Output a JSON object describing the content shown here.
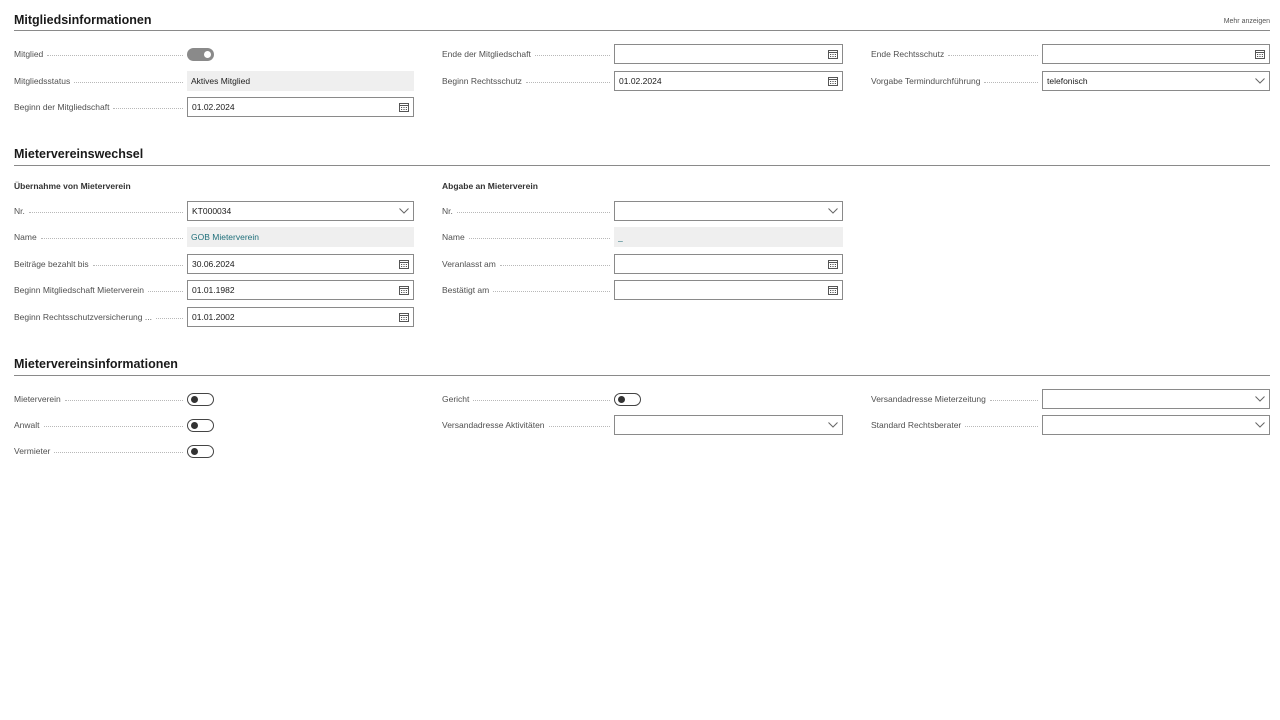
{
  "header": {
    "more_link": "Mehr anzeigen"
  },
  "sections": {
    "mitglied": "Mitgliedsinformationen",
    "wechsel": "Mietervereinswechsel",
    "info": "Mietervereinsinformationen"
  },
  "mitglied": {
    "mitglied_label": "Mitglied",
    "mitglied_toggle": "on",
    "status_label": "Mitgliedsstatus",
    "status_value": "Aktives Mitglied",
    "beginn_label": "Beginn der Mitgliedschaft",
    "beginn_value": "01.02.2024",
    "ende_label": "Ende der Mitgliedschaft",
    "ende_value": "",
    "beginn_rs_label": "Beginn Rechtsschutz",
    "beginn_rs_value": "01.02.2024",
    "ende_rs_label": "Ende Rechtsschutz",
    "ende_rs_value": "",
    "vorgabe_label": "Vorgabe Termindurchführung",
    "vorgabe_value": "telefonisch"
  },
  "wechsel": {
    "uebernahme_title": "Übernahme von Mieterverein",
    "abgabe_title": "Abgabe an Mieterverein",
    "nr_label": "Nr.",
    "nr_value": "KT000034",
    "name_label": "Name",
    "name_value": "GOB Mieterverein",
    "beitraege_label": "Beiträge bezahlt bis",
    "beitraege_value": "30.06.2024",
    "beginn_mv_label": "Beginn Mitgliedschaft Mieterverein",
    "beginn_mv_value": "01.01.1982",
    "beginn_rsv_label": "Beginn Rechtsschutzversicherung ...",
    "beginn_rsv_value": "01.01.2002",
    "abgabe_nr_label": "Nr.",
    "abgabe_nr_value": "",
    "abgabe_name_label": "Name",
    "abgabe_name_value": "_",
    "veranlasst_label": "Veranlasst am",
    "veranlasst_value": "",
    "bestaetigt_label": "Bestätigt am",
    "bestaetigt_value": ""
  },
  "info": {
    "mieterverein_label": "Mieterverein",
    "mieterverein_toggle": "off",
    "anwalt_label": "Anwalt",
    "anwalt_toggle": "off",
    "vermieter_label": "Vermieter",
    "vermieter_toggle": "off",
    "gericht_label": "Gericht",
    "gericht_toggle": "off",
    "versand_akt_label": "Versandadresse Aktivitäten",
    "versand_akt_value": "",
    "versand_mz_label": "Versandadresse Mieterzeitung",
    "versand_mz_value": "",
    "standard_rb_label": "Standard Rechtsberater",
    "standard_rb_value": ""
  }
}
